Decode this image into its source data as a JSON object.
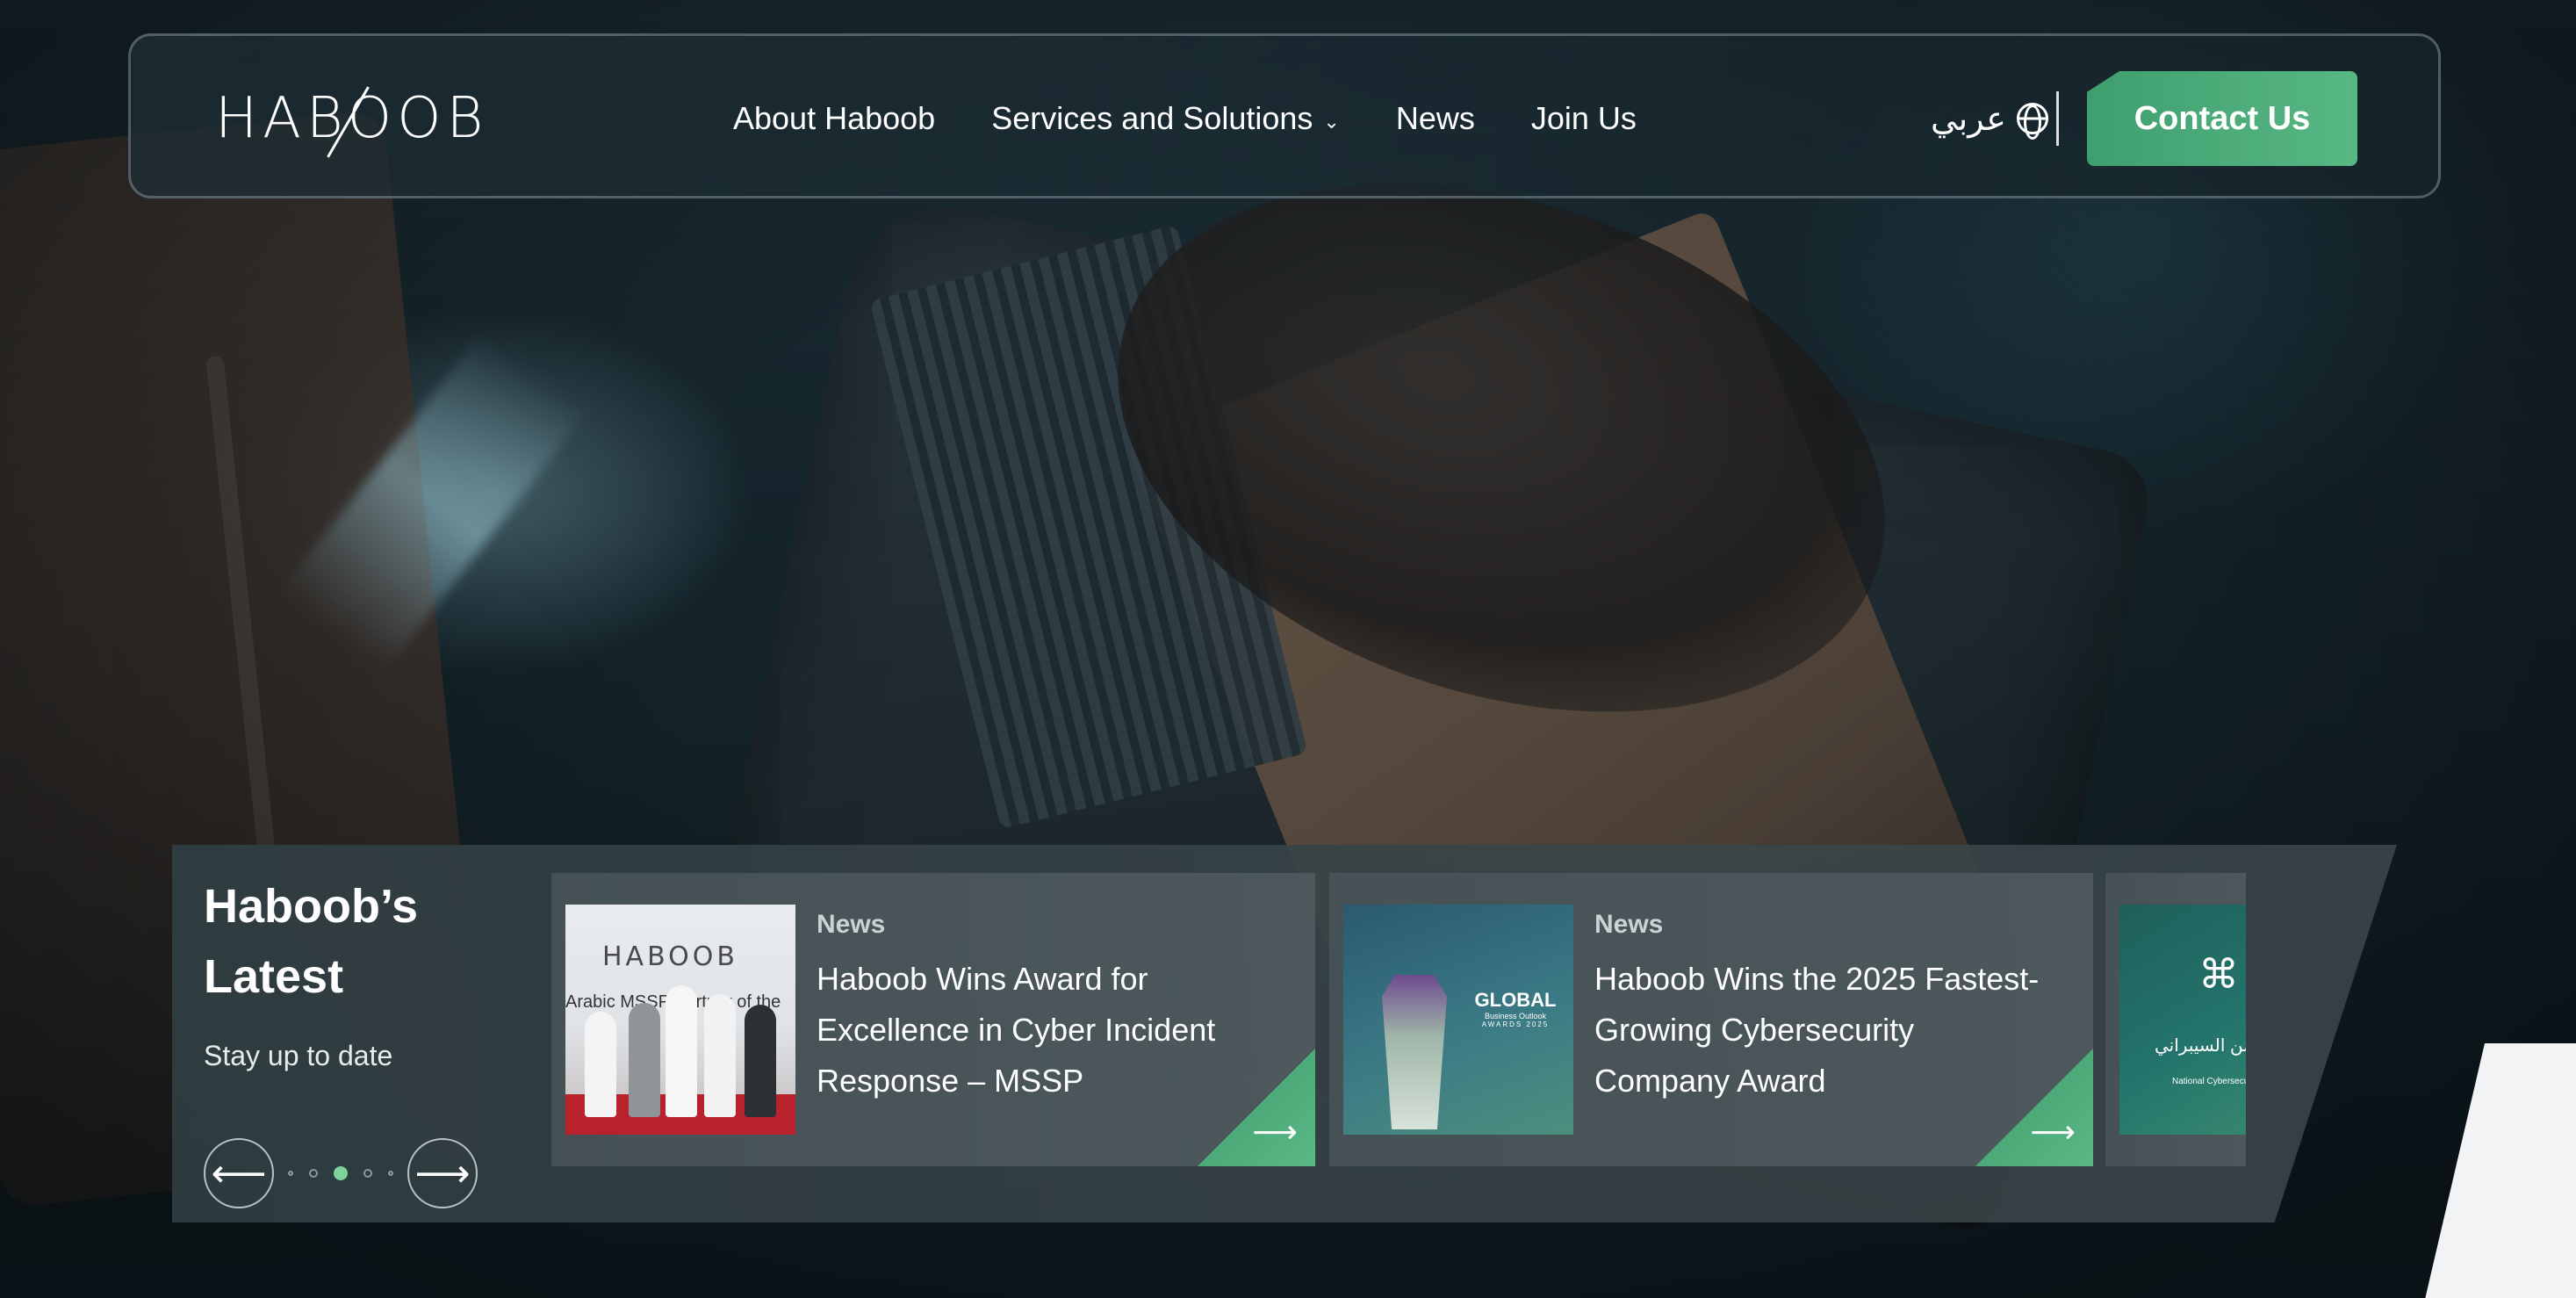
{
  "header": {
    "logo_text": "HABOOB",
    "nav": [
      {
        "label": "About Haboob"
      },
      {
        "label": "Services and Solutions",
        "has_dropdown": true
      },
      {
        "label": "News"
      },
      {
        "label": "Join Us"
      }
    ],
    "language_label": "عربي",
    "contact_label": "Contact Us"
  },
  "latest": {
    "title": "Haboob’s Latest",
    "subtitle": "Stay up to date",
    "dots_active_index": 2,
    "cards": [
      {
        "category": "News",
        "headline": "Haboob Wins Award for Excellence in Cyber Incident Response – MSSP",
        "thumb_brand": "HABOOB",
        "thumb_banner": "Arabic MSSP Partner of the"
      },
      {
        "category": "News",
        "headline": "Haboob Wins the 2025 Fastest-Growing Cybersecurity Company Award",
        "thumb_title": "GLOBAL",
        "thumb_sub": "Business Outlook",
        "thumb_sub2": "AWARDS 2025"
      },
      {
        "thumb_ar": "الهيئة الوطنية للأمن السيبراني",
        "thumb_en": "National Cybersecurity Authority"
      }
    ]
  },
  "colors": {
    "accent_green": "#58b884",
    "accent_green_dark": "#3f9e6e",
    "text": "#ffffff"
  },
  "icons": {
    "language": "globe-icon",
    "prev": "arrow-left-icon",
    "next": "arrow-right-icon",
    "card_link": "arrow-right-icon",
    "dropdown": "chevron-down-icon"
  }
}
